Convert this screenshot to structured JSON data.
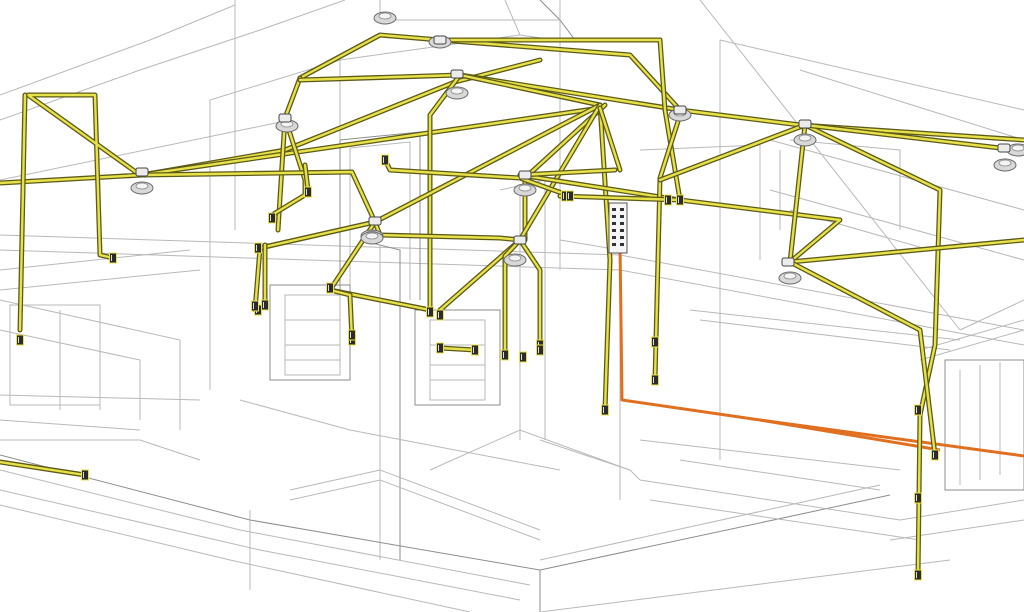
{
  "view": {
    "background": "#ffffff",
    "colors": {
      "architecture_lines": "#b9b9b9",
      "wire_outline": "#5d5a18",
      "wire_fill": "#e7e14a",
      "service_feed": "#e07020",
      "device_box": "#2b2b2b",
      "fixture": "#d8d8d8"
    }
  },
  "wiring_segments": 36,
  "service_feeds": 2,
  "ceiling_fixtures": 14,
  "junction_boxes": 11,
  "wall_devices": 33,
  "panels": 1
}
